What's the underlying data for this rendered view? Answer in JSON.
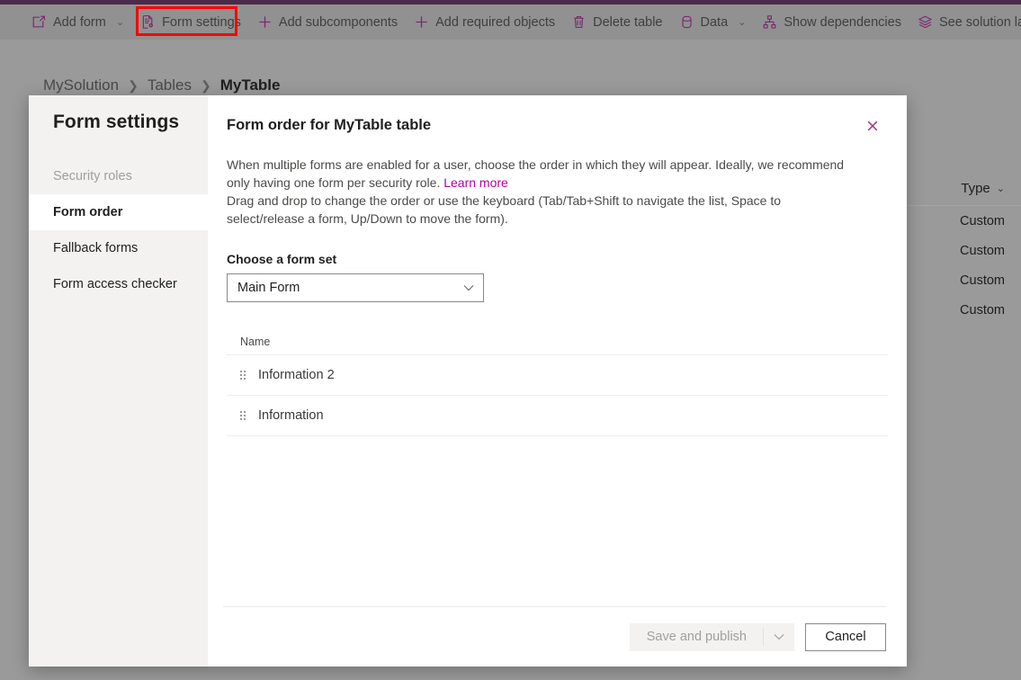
{
  "theme": {
    "accent_purple": "#7a2a6e",
    "top_accent": "#4c2a4a",
    "link_magenta": "#b4009e",
    "highlight_red": "#ff0000",
    "overlay_gray": "#9a9a9a",
    "nav_bg": "#f3f2f1"
  },
  "command_bar": {
    "items": [
      {
        "label": "Add form",
        "icon": "new-form-icon",
        "has_chevron": true
      },
      {
        "label": "Form settings",
        "icon": "form-settings-icon",
        "has_chevron": false,
        "highlighted": true
      },
      {
        "label": "Add subcomponents",
        "icon": "plus-icon",
        "has_chevron": false
      },
      {
        "label": "Add required objects",
        "icon": "plus-icon",
        "has_chevron": false
      },
      {
        "label": "Delete table",
        "icon": "trash-icon",
        "has_chevron": false
      },
      {
        "label": "Data",
        "icon": "database-icon",
        "has_chevron": true
      },
      {
        "label": "Show dependencies",
        "icon": "dependencies-icon",
        "has_chevron": false
      },
      {
        "label": "See solution layers",
        "icon": "layers-icon",
        "has_chevron": false
      }
    ]
  },
  "breadcrumb": {
    "items": [
      "MySolution",
      "Tables",
      "MyTable"
    ],
    "separator": "❯"
  },
  "background_grid": {
    "column_header": "Type",
    "header_chevron": "⌄",
    "cells": [
      "Custom",
      "Custom",
      "Custom",
      "Custom"
    ]
  },
  "dialog": {
    "nav_title": "Form settings",
    "nav_items": [
      {
        "label": "Security roles",
        "state": "disabled"
      },
      {
        "label": "Form order",
        "state": "selected"
      },
      {
        "label": "Fallback forms",
        "state": "normal"
      },
      {
        "label": "Form access checker",
        "state": "normal"
      }
    ],
    "heading": "Form order for MyTable table",
    "close_icon": "close-icon",
    "description_part1": "When multiple forms are enabled for a user, choose the order in which they will appear. Ideally, we recommend only having one form per security role. ",
    "learn_more": "Learn more",
    "description_part2": "Drag and drop to change the order or use the keyboard (Tab/Tab+Shift to navigate the list, Space to select/release a form, Up/Down to move the form).",
    "form_set_label": "Choose a form set",
    "form_set_value": "Main Form",
    "form_set_chevron": "⌄",
    "form_set_options": [
      "Main Form"
    ],
    "list_column_header": "Name",
    "forms": [
      {
        "name": "Information 2",
        "handle": "drag-handle-icon"
      },
      {
        "name": "Information",
        "handle": "drag-handle-icon"
      }
    ],
    "footer": {
      "save_label": "Save and publish",
      "save_disabled": true,
      "save_chevron": "⌄",
      "cancel_label": "Cancel"
    }
  }
}
